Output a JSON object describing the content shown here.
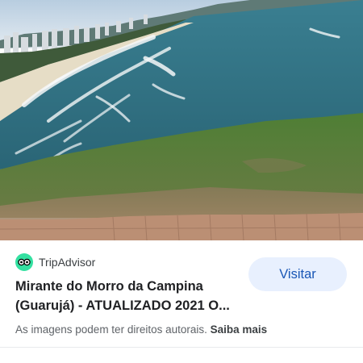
{
  "image": {
    "description_icon": "landscape-photo",
    "colors": {
      "sky": "#c9d9e6",
      "sea": "#2f6e80",
      "grass": "#557a3a",
      "dirt": "#8c6f55",
      "pavement": "#b88d72"
    }
  },
  "result": {
    "source": {
      "name": "TripAdvisor",
      "icon": "tripadvisor-owl-icon",
      "color": "#34e0a1"
    },
    "title_line1": "Mirante do Morro da Campina",
    "title_line2": "(Guarujá) - ATUALIZADO 2021 O...",
    "visit_label": "Visitar",
    "rights_text": "As imagens podem ter direitos autorais.",
    "more_label": "Saiba mais"
  }
}
